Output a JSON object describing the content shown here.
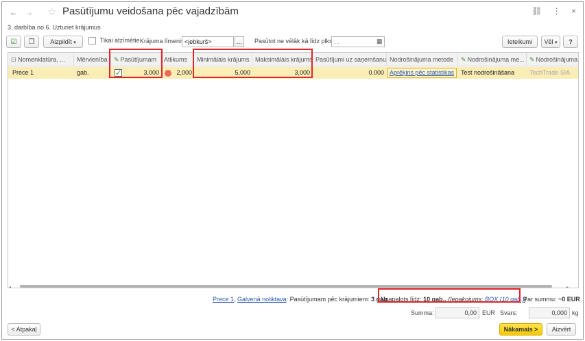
{
  "window": {
    "title": "Pasūtījumu veidošana pēc vajadzībām",
    "subtitle": "3. darbība no 6. Uzturiet krājumus",
    "link_icon": "link-icon",
    "menu_icon": "more-icon",
    "close_icon": "close-icon"
  },
  "toolbar": {
    "fill_label": "Aizpildīt",
    "only_marked_label": "Tikai atzīmētie",
    "stock_level_label": "Krājuma līmenis:",
    "stock_level_value": "<jebkurš>",
    "order_until_label": "Pasūtot ne vēlāk kā līdz plkst:",
    "order_until_value": " .  .",
    "settings_label": "Ieteikumi",
    "more_label": "Vēl",
    "help_label": "?"
  },
  "table": {
    "headers": {
      "nomenclature": "Nomenklatūra, ...",
      "unit": "Mērvienība",
      "ordered": "Pasūtījumam",
      "stock": "Atlikums",
      "min_stock": "Minimālais krājums",
      "max_stock": "Maksimālais krājums",
      "orders_receipt": "Pasūtījumi uz saņemšanu",
      "method": "Nodrošinājuma metode",
      "supply_method": "Nodrošinājuma me...",
      "supplier": "Nodrošinājuma"
    },
    "rows": [
      {
        "nomenclature": "Prece 1",
        "unit": "gab.",
        "ordered": "3,000",
        "stock": "2,000",
        "min_stock": "5,000",
        "max_stock": "3,000",
        "orders_receipt": "0.000",
        "method": "Aprēķins pēc statistikas",
        "supply_method": "Test nodrošināšana",
        "supplier": "TechTrade SIA"
      }
    ]
  },
  "footer": {
    "item_link": "Prece 1",
    "warehouse_link": "Galvenā noliktava",
    "to_order_text": ": Pasūtījumam pēc krājumiem:",
    "to_order_qty": "3 gab.",
    "rounded_label": "Noapaļots līdz:",
    "rounded_qty": "10 gab.,",
    "packaging_label": "(Iepakojums:",
    "packaging_link": "BOX (10 gab.)",
    "packaging_close": ")",
    "sum_text": "Par summu:",
    "sum_value": "~0 EUR",
    "summa_label": "Summa:",
    "summa_value": "0,00",
    "currency": "EUR",
    "weight_label": "Svars:",
    "weight_value": "0,000",
    "weight_unit": "kg"
  },
  "bottom": {
    "back_label": "< Atpakaļ",
    "next_label": "Nākamais >",
    "close_label": "Aizvērt"
  }
}
